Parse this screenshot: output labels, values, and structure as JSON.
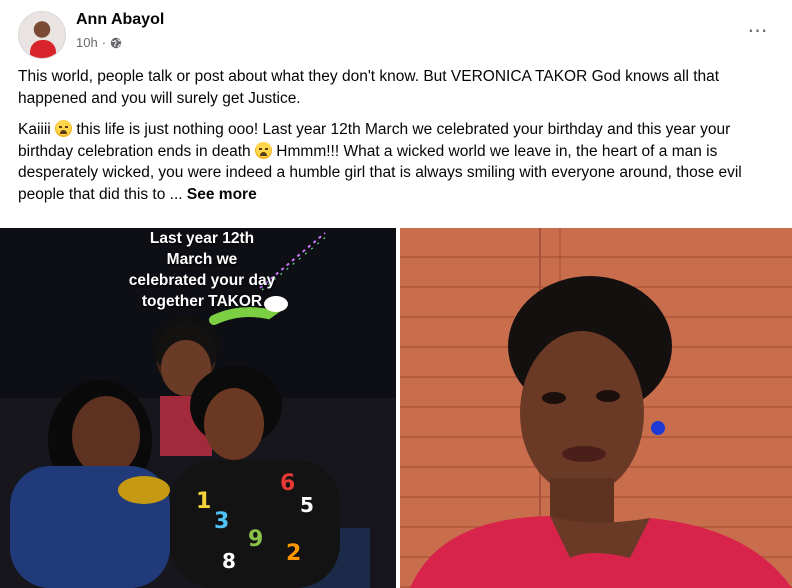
{
  "post": {
    "author": "Ann Abayol",
    "time": "10h",
    "paragraph1": "This world, people talk or post about what they don't know. But VERONICA TAKOR God knows all that happened and you will surely get Justice.",
    "paragraph2_a": "Kaiiii",
    "paragraph2_b": "this life is just nothing ooo! Last year 12th March we celebrated your birthday and this year your birthday celebration ends in death",
    "paragraph2_c": "Hmmm!!! What a wicked world we leave in, the heart of a man is desperately wicked, you were indeed a humble girl that is always smiling with everyone around, those evil people that did this to ...",
    "see_more": "See more",
    "more_icon": "⋯"
  },
  "photo_left": {
    "caption_lines": [
      "Last year 12th",
      "March we",
      "celebrated your day",
      "together TAKOR"
    ]
  },
  "icons": {
    "globe": "globe-icon",
    "emoji": "crying-face-icon",
    "more": "ellipsis-icon"
  }
}
